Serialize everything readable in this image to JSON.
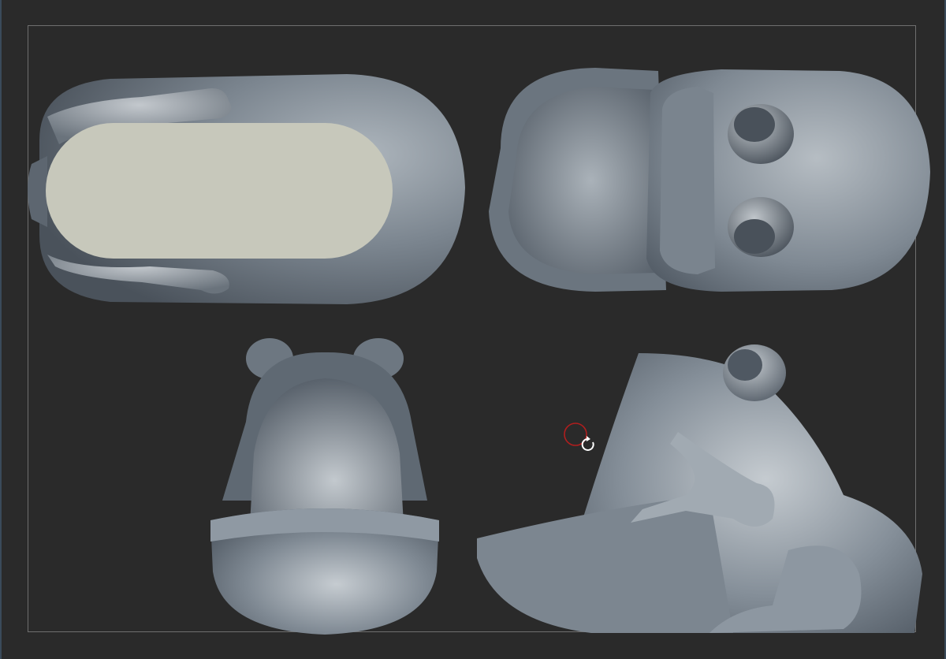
{
  "scene": {
    "views": [
      "top-view",
      "bottom-view",
      "front-view",
      "side-view"
    ],
    "colors": {
      "background": "#2a2a2a",
      "frame": "#6f6f6f",
      "clay_light": "#c9ced3",
      "clay_mid": "#8a949e",
      "clay_dark": "#4a525b",
      "flat_cut": "#c7c8bb",
      "brush_ring": "#b01e1e"
    }
  },
  "cursor": {
    "brush_icon": "brush-circle-icon",
    "rotate_icon": "rotate-cursor-icon"
  }
}
